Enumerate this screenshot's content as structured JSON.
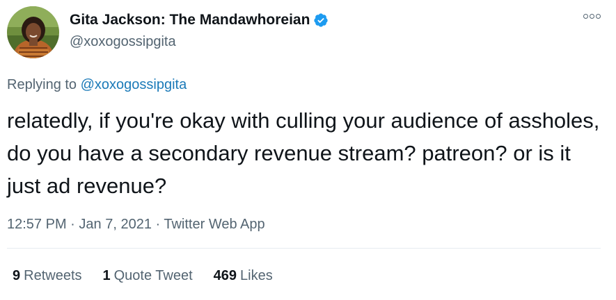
{
  "author": {
    "display_name": "Gita Jackson: The Mandawhoreian",
    "handle": "@xoxogossipgita",
    "verified": true
  },
  "reply": {
    "prefix": "Replying to",
    "to_handle": "@xoxogossipgita"
  },
  "tweet": {
    "text": "relatedly, if you're okay with culling your audience of assholes, do you have a secondary revenue stream? patreon? or is it just ad revenue?"
  },
  "meta": {
    "time": "12:57 PM",
    "separator1": "·",
    "date": "Jan 7, 2021",
    "separator2": "·",
    "source": "Twitter Web App"
  },
  "stats": {
    "retweets_count": "9",
    "retweets_label": "Retweets",
    "quotes_count": "1",
    "quotes_label": "Quote Tweet",
    "likes_count": "469",
    "likes_label": "Likes"
  },
  "icons": {
    "verified": "verified-badge-icon",
    "more": "more-options-icon"
  },
  "colors": {
    "link": "#1b7ab8",
    "secondary_text": "#536471",
    "verified_badge": "#1d9bf0",
    "divider": "#e6ecf0"
  }
}
